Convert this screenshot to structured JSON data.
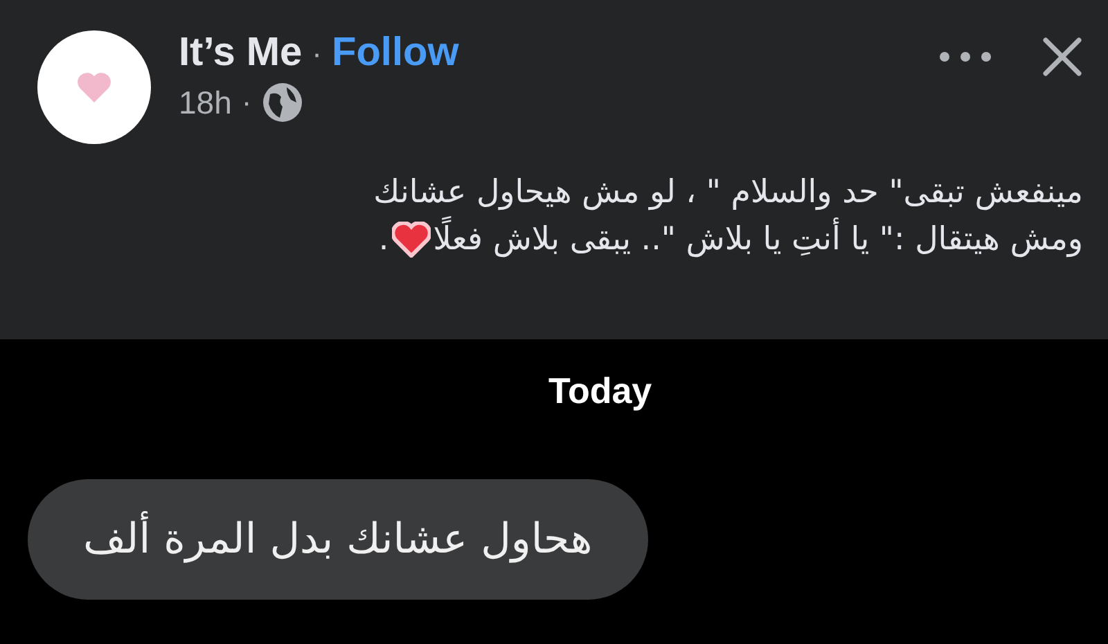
{
  "post": {
    "author": "It’s Me",
    "separator": "·",
    "follow": "Follow",
    "time": "18h",
    "time_separator": "·",
    "text_lines": [
      "مينفعش تبقى\" حد والسلام \" ، لو مش هيحاول عشانك",
      "ومش هيتقال :\" يا أنتِ يا بلاش \".. يبقى بلاش فعلًا"
    ],
    "text_end": "."
  },
  "chat": {
    "date": "Today",
    "messages": [
      {
        "text": "هحاول عشانك بدل المرة ألف"
      }
    ]
  }
}
